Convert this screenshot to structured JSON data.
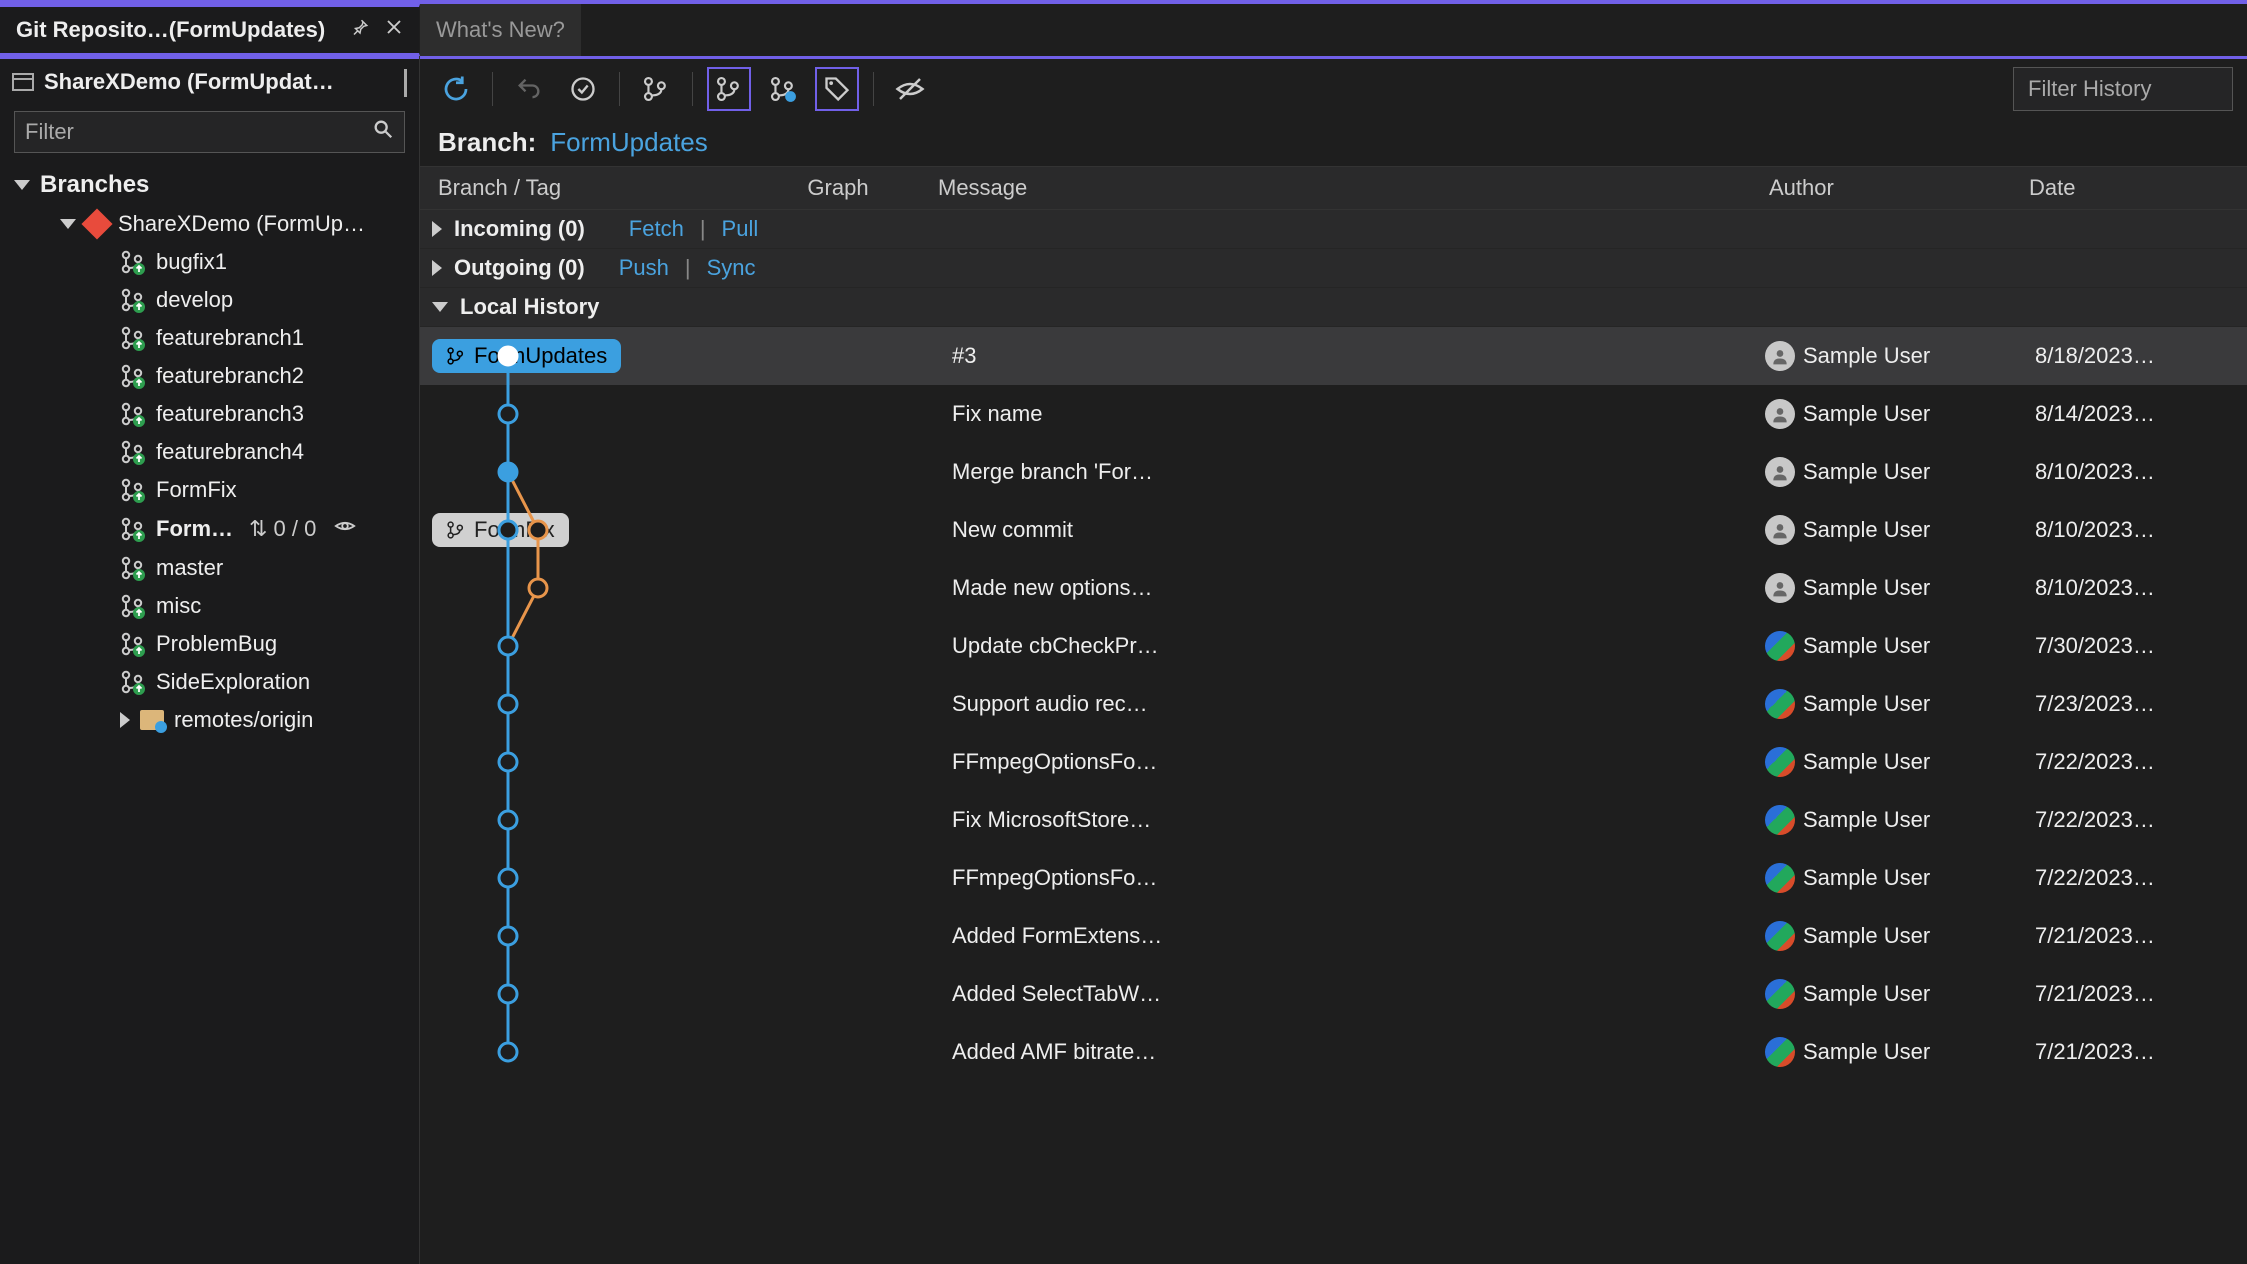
{
  "tabs": {
    "active": "Git Reposito…(FormUpdates)",
    "inactive": "What's New?"
  },
  "sidebar": {
    "title": "ShareXDemo (FormUpdat…",
    "filter_placeholder": "Filter",
    "branches_label": "Branches",
    "repo_label": "ShareXDemo (FormUp…",
    "branches": [
      {
        "name": "bugfix1"
      },
      {
        "name": "develop"
      },
      {
        "name": "featurebranch1"
      },
      {
        "name": "featurebranch2"
      },
      {
        "name": "featurebranch3"
      },
      {
        "name": "featurebranch4"
      },
      {
        "name": "FormFix"
      },
      {
        "name": "Form…",
        "current": true,
        "counts": "0 / 0"
      },
      {
        "name": "master"
      },
      {
        "name": "misc"
      },
      {
        "name": "ProblemBug"
      },
      {
        "name": "SideExploration"
      }
    ],
    "remotes_label": "remotes/origin"
  },
  "toolbar": {
    "filter_history_placeholder": "Filter History"
  },
  "branch_header": {
    "label": "Branch:",
    "value": "FormUpdates"
  },
  "columns": {
    "branch": "Branch / Tag",
    "graph": "Graph",
    "message": "Message",
    "author": "Author",
    "date": "Date"
  },
  "incoming": {
    "title": "Incoming (0)",
    "fetch": "Fetch",
    "pull": "Pull"
  },
  "outgoing": {
    "title": "Outgoing (0)",
    "push": "Push",
    "sync": "Sync"
  },
  "local_history_label": "Local History",
  "history": [
    {
      "branch_pill": "FormUpdates",
      "pill_style": "active",
      "message": "#3",
      "author": "Sample User",
      "date": "8/18/2023…",
      "avatar": "gray",
      "selected": true
    },
    {
      "message": "Fix name",
      "author": "Sample User",
      "date": "8/14/2023…",
      "avatar": "gray"
    },
    {
      "message": "Merge branch 'For…",
      "author": "Sample User",
      "date": "8/10/2023…",
      "avatar": "gray"
    },
    {
      "branch_pill": "FormFix",
      "pill_style": "inactive",
      "message": "New commit",
      "author": "Sample User",
      "date": "8/10/2023…",
      "avatar": "gray"
    },
    {
      "message": "Made new options…",
      "author": "Sample User",
      "date": "8/10/2023…",
      "avatar": "gray"
    },
    {
      "message": "Update cbCheckPr…",
      "author": "Sample User",
      "date": "7/30/2023…",
      "avatar": "colorful"
    },
    {
      "message": "Support audio rec…",
      "author": "Sample User",
      "date": "7/23/2023…",
      "avatar": "colorful"
    },
    {
      "message": "FFmpegOptionsFo…",
      "author": "Sample User",
      "date": "7/22/2023…",
      "avatar": "colorful"
    },
    {
      "message": "Fix MicrosoftStore…",
      "author": "Sample User",
      "date": "7/22/2023…",
      "avatar": "colorful"
    },
    {
      "message": "FFmpegOptionsFo…",
      "author": "Sample User",
      "date": "7/22/2023…",
      "avatar": "colorful"
    },
    {
      "message": "Added FormExtens…",
      "author": "Sample User",
      "date": "7/21/2023…",
      "avatar": "colorful"
    },
    {
      "message": "Added SelectTabW…",
      "author": "Sample User",
      "date": "7/21/2023…",
      "avatar": "colorful"
    },
    {
      "message": "Added AMF bitrate…",
      "author": "Sample User",
      "date": "7/21/2023…",
      "avatar": "colorful"
    }
  ]
}
